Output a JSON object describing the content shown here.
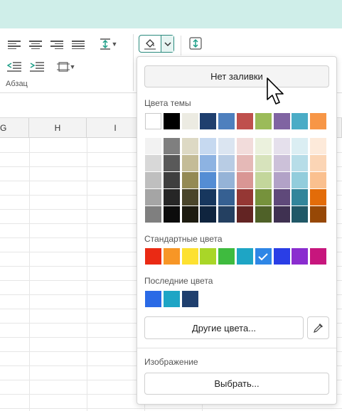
{
  "ribbon": {
    "group_label": "Абзац"
  },
  "columns": [
    "G",
    "H",
    "I"
  ],
  "fill_menu": {
    "no_fill": "Нет заливки",
    "theme_label": "Цвета темы",
    "theme_colors": [
      "#ffffff",
      "#000000",
      "#ecebe2",
      "#1f3f6e",
      "#4e80be",
      "#bf504d",
      "#9bbb59",
      "#8064a2",
      "#4bacc6",
      "#f79646"
    ],
    "shade_columns": [
      [
        "#f2f2f2",
        "#d8d8d8",
        "#bfbfbf",
        "#a5a5a5",
        "#7f7f7f"
      ],
      [
        "#7f7f7f",
        "#595959",
        "#3f3f3f",
        "#262626",
        "#0c0c0c"
      ],
      [
        "#ddd9c4",
        "#c4bc97",
        "#948a54",
        "#4a452a",
        "#1d1b10"
      ],
      [
        "#c6d9f0",
        "#8db3e2",
        "#548dd4",
        "#17375e",
        "#0f243e"
      ],
      [
        "#dbe5f1",
        "#b8cce4",
        "#95b3d7",
        "#366092",
        "#244061"
      ],
      [
        "#f2dcdb",
        "#e5b9b7",
        "#d99694",
        "#953734",
        "#632423"
      ],
      [
        "#ebf1dd",
        "#d7e3bc",
        "#c3d69b",
        "#76923c",
        "#4f6128"
      ],
      [
        "#e5e0ec",
        "#ccc1d9",
        "#b2a2c7",
        "#5f497a",
        "#3f3151"
      ],
      [
        "#dbeef3",
        "#b7dde8",
        "#92cddc",
        "#31859b",
        "#205867"
      ],
      [
        "#fdeada",
        "#fbd5b5",
        "#fac08f",
        "#e36c09",
        "#974806"
      ]
    ],
    "standard_label": "Стандартные цвета",
    "standard_colors": [
      "#ea2a14",
      "#f79626",
      "#fde131",
      "#a9d628",
      "#3fbb3f",
      "#1ea5c5",
      "#2e86e6",
      "#2a3ee6",
      "#8a2dcf",
      "#c7167d"
    ],
    "standard_selected_index": 6,
    "recent_label": "Последние цвета",
    "recent_colors": [
      "#2a6ae6",
      "#1ea5c5",
      "#1f3f6e"
    ],
    "more_colors": "Другие цвета...",
    "image_label": "Изображение",
    "choose": "Выбрать..."
  }
}
